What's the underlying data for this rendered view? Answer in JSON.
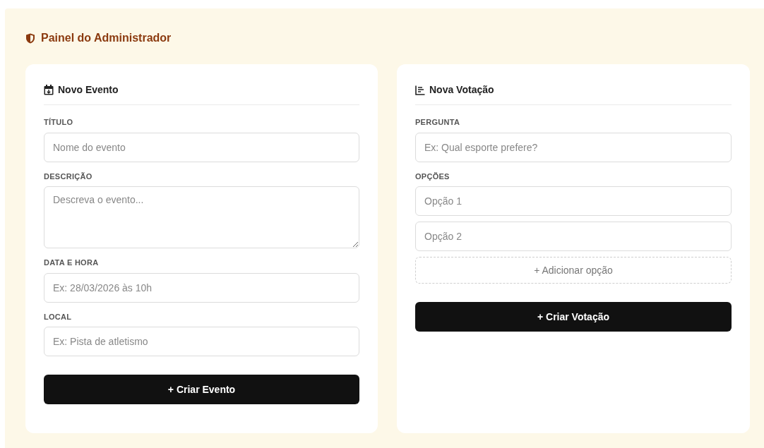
{
  "panel": {
    "title": "Painel do Administrador"
  },
  "event_card": {
    "title": "Novo Evento",
    "fields": [
      {
        "kind": "input",
        "label": "TÍTULO",
        "placeholder": "Nome do evento"
      },
      {
        "kind": "textarea",
        "label": "DESCRIÇÃO",
        "placeholder": "Descreva o evento..."
      },
      {
        "kind": "input",
        "label": "DATA E HORA",
        "placeholder": "Ex: 28/03/2026 às 10h"
      },
      {
        "kind": "input",
        "label": "LOCAL",
        "placeholder": "Ex: Pista de atletismo"
      }
    ],
    "button": "+ Criar Evento"
  },
  "poll_card": {
    "title": "Nova Votação",
    "question": {
      "label": "PERGUNTA",
      "placeholder": "Ex: Qual esporte prefere?"
    },
    "options_label": "OPÇÕES",
    "options": [
      {
        "placeholder": "Opção 1"
      },
      {
        "placeholder": "Opção 2"
      }
    ],
    "add_button": "+ Adicionar opção",
    "button": "+ Criar Votação"
  }
}
